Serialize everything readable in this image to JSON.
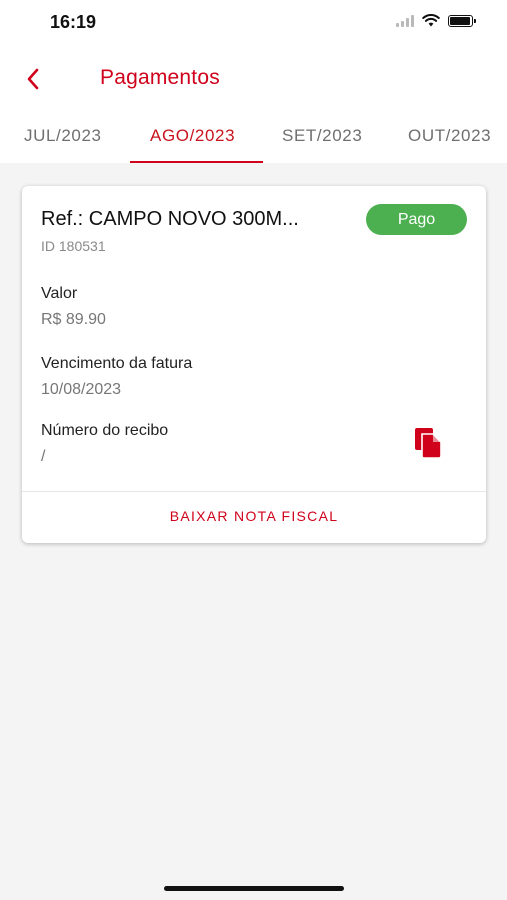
{
  "status_bar": {
    "time": "16:19",
    "icons": [
      "cellular-signal-icon",
      "wifi-icon",
      "battery-icon"
    ]
  },
  "header": {
    "back_icon": "chevron-left-icon",
    "title": "Pagamentos"
  },
  "tabs": [
    {
      "label": "JUL/2023",
      "active": false
    },
    {
      "label": "AGO/2023",
      "active": true
    },
    {
      "label": "SET/2023",
      "active": false
    },
    {
      "label": "OUT/2023",
      "active": false
    }
  ],
  "payment_card": {
    "reference": "Ref.: CAMPO NOVO 300M...",
    "id_text": "ID 180531",
    "status": "Pago",
    "amount_label": "Valor",
    "amount_value": "R$ 89.90",
    "due_label": "Vencimento da fatura",
    "due_value": "10/08/2023",
    "receipt_label": "Número do recibo",
    "receipt_value": "/",
    "copy_icon": "copy-document-icon",
    "download_label": "BAIXAR NOTA FISCAL"
  },
  "colors": {
    "accent": "#d0021b",
    "status_paid": "#4caf50",
    "background": "#f4f4f4"
  }
}
